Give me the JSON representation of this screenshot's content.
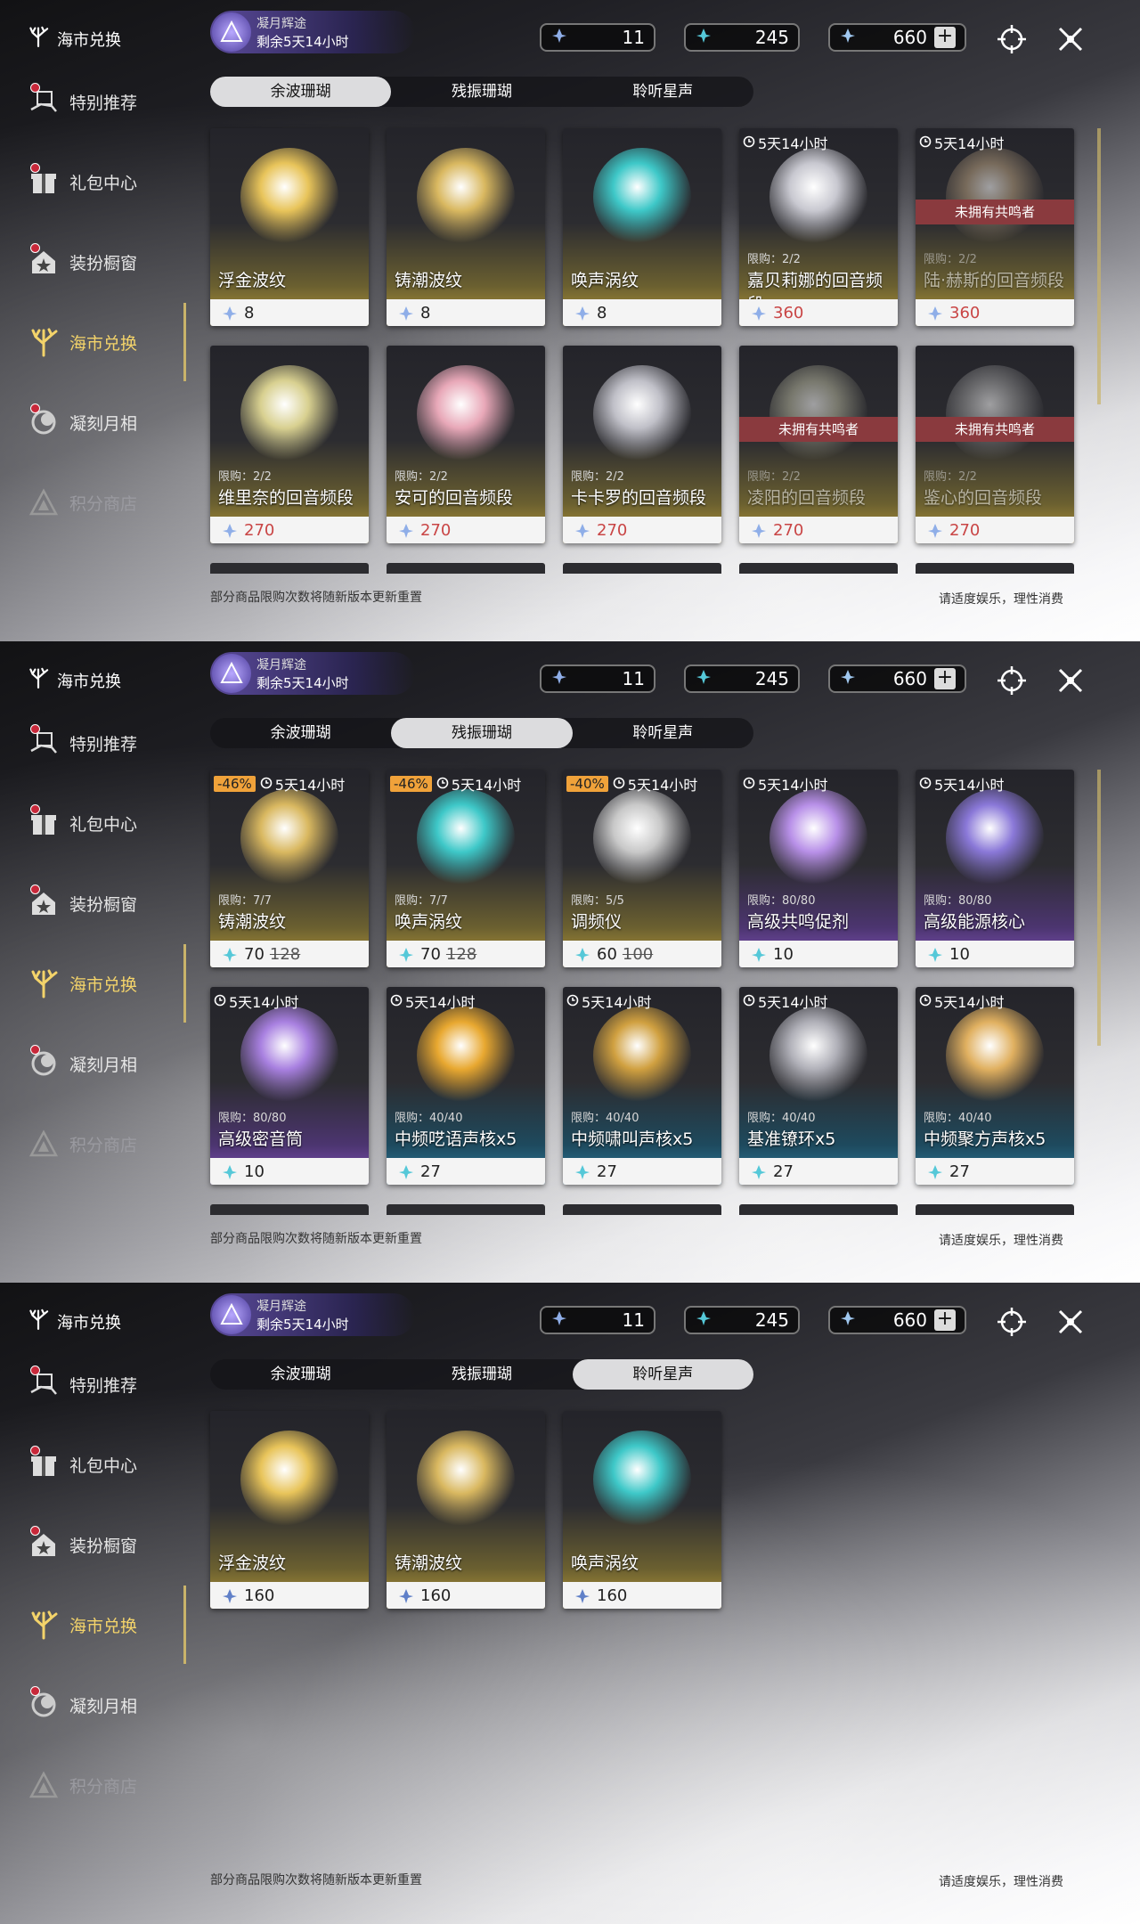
{
  "sidebar": {
    "title": "海市兑换",
    "items": [
      {
        "label": "特别推荐",
        "icon": "hand-gift-icon",
        "dot": true
      },
      {
        "label": "礼包中心",
        "icon": "gift-box-icon",
        "dot": true
      },
      {
        "label": "装扮橱窗",
        "icon": "house-star-icon",
        "dot": true
      },
      {
        "label": "海市兑换",
        "icon": "coral-icon",
        "dot": false,
        "active": true
      },
      {
        "label": "凝刻月相",
        "icon": "moon-medal-icon",
        "dot": true
      },
      {
        "label": "积分商店",
        "icon": "triangle-shop-icon",
        "dot": false,
        "dim": true
      }
    ]
  },
  "event": {
    "line1": "凝月辉途",
    "line2": "剩余5天14小时"
  },
  "currencies": [
    {
      "name": "afterglow-coral",
      "value": "11"
    },
    {
      "name": "oscillated-coral",
      "value": "245"
    },
    {
      "name": "star-currency",
      "value": "660"
    }
  ],
  "tabs": [
    "余波珊瑚",
    "残振珊瑚",
    "聆听星声"
  ],
  "footer": {
    "left": "部分商品限购次数将随新版本更新重置",
    "right": "请适度娱乐，理性消费"
  },
  "panels": [
    {
      "active_tab": 0,
      "cards": [
        {
          "name": "浮金波纹",
          "price": "8",
          "style": "gold",
          "img": "#e8c45a"
        },
        {
          "name": "铸潮波纹",
          "price": "8",
          "style": "gold",
          "img": "#d9b860"
        },
        {
          "name": "唤声涡纹",
          "price": "8",
          "style": "gold",
          "img": "#3ec8c8"
        },
        {
          "name": "嘉贝莉娜的回音频段",
          "price": "360",
          "style": "gold",
          "img": "#c8c8d0",
          "timer": "5天14小时",
          "limit": "限购：2/2",
          "red": true
        },
        {
          "name": "陆·赫斯的回音频段",
          "price": "360",
          "style": "gold",
          "img": "#b8a080",
          "timer": "5天14小时",
          "limit": "限购：2/2",
          "red": true,
          "locked": "未拥有共鸣者",
          "faded": true
        },
        {
          "name": "维里奈的回音频段",
          "price": "270",
          "style": "gold",
          "img": "#d8d090",
          "limit": "限购：2/2",
          "red": true
        },
        {
          "name": "安可的回音频段",
          "price": "270",
          "style": "gold",
          "img": "#e8a8b8",
          "limit": "限购：2/2",
          "red": true
        },
        {
          "name": "卡卡罗的回音频段",
          "price": "270",
          "style": "gold",
          "img": "#c0c0c8",
          "limit": "限购：2/2",
          "red": true
        },
        {
          "name": "凌阳的回音频段",
          "price": "270",
          "style": "gold",
          "img": "#b8b8a0",
          "limit": "限购：2/2",
          "red": true,
          "locked": "未拥有共鸣者",
          "faded": true
        },
        {
          "name": "鉴心的回音频段",
          "price": "270",
          "style": "gold",
          "img": "#a0a0a0",
          "limit": "限购：2/2",
          "red": true,
          "locked": "未拥有共鸣者",
          "faded": true
        }
      ]
    },
    {
      "active_tab": 1,
      "cards": [
        {
          "name": "铸潮波纹",
          "price": "70",
          "old": "128",
          "style": "gold",
          "img": "#d9b860",
          "timer": "5天14小时",
          "discount": "-46%",
          "limit": "限购：7/7"
        },
        {
          "name": "唤声涡纹",
          "price": "70",
          "old": "128",
          "style": "gold",
          "img": "#3ec8c8",
          "timer": "5天14小时",
          "discount": "-46%",
          "limit": "限购：7/7"
        },
        {
          "name": "调频仪",
          "price": "60",
          "old": "100",
          "style": "gold",
          "img": "#c8c8c8",
          "timer": "5天14小时",
          "discount": "-40%",
          "limit": "限购：5/5"
        },
        {
          "name": "高级共鸣促剂",
          "price": "10",
          "style": "purple",
          "img": "#b890e8",
          "timer": "5天14小时",
          "limit": "限购：80/80"
        },
        {
          "name": "高级能源核心",
          "price": "10",
          "style": "purple",
          "img": "#8a78d8",
          "timer": "5天14小时",
          "limit": "限购：80/80"
        },
        {
          "name": "高级密音筒",
          "price": "10",
          "style": "purple",
          "img": "#a880e0",
          "timer": "5天14小时",
          "limit": "限购：80/80"
        },
        {
          "name": "中频呓语声核x5",
          "price": "27",
          "style": "blue",
          "img": "#e8a830",
          "timer": "5天14小时",
          "limit": "限购：40/40"
        },
        {
          "name": "中频啸叫声核x5",
          "price": "27",
          "style": "blue",
          "img": "#d0a040",
          "timer": "5天14小时",
          "limit": "限购：40/40"
        },
        {
          "name": "基准镣环x5",
          "price": "27",
          "style": "blue",
          "img": "#b0b0b8",
          "timer": "5天14小时",
          "limit": "限购：40/40"
        },
        {
          "name": "中频聚方声核x5",
          "price": "27",
          "style": "blue",
          "img": "#e0b060",
          "timer": "5天14小时",
          "limit": "限购：40/40"
        }
      ]
    },
    {
      "active_tab": 2,
      "cards": [
        {
          "name": "浮金波纹",
          "price": "160",
          "style": "gold",
          "img": "#e8c45a"
        },
        {
          "name": "铸潮波纹",
          "price": "160",
          "style": "gold",
          "img": "#d9b860"
        },
        {
          "name": "唤声涡纹",
          "price": "160",
          "style": "gold",
          "img": "#3ec8c8"
        }
      ]
    }
  ]
}
